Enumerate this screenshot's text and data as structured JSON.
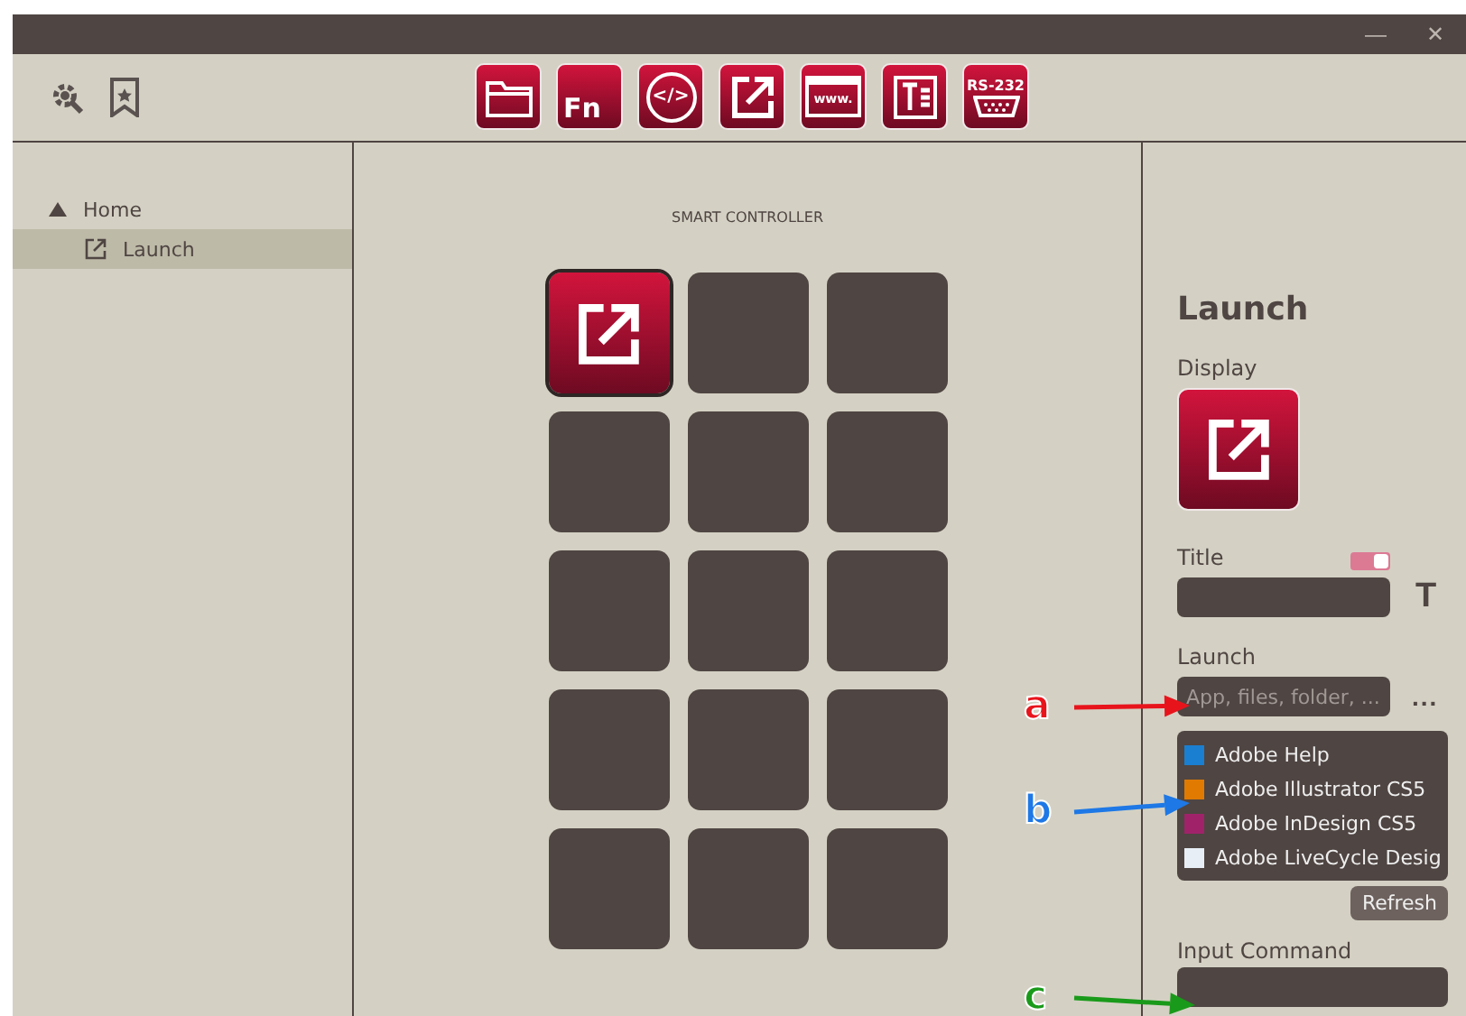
{
  "window": {
    "title_bar": {
      "minimize": "—",
      "close": "✕"
    }
  },
  "toolbar": {
    "tools": [
      {
        "kind": "folder"
      },
      {
        "kind": "fn",
        "label": "Fn"
      },
      {
        "kind": "code",
        "label": "</>"
      },
      {
        "kind": "launch"
      },
      {
        "kind": "browser",
        "label": "www."
      },
      {
        "kind": "text"
      },
      {
        "kind": "serial",
        "label": "RS-232"
      }
    ]
  },
  "sidebar": {
    "items": [
      {
        "label": "Home",
        "expanded": true,
        "selected": false,
        "children": [
          {
            "label": "Launch",
            "selected": true
          }
        ]
      }
    ]
  },
  "canvas": {
    "title": "SMART CONTROLLER",
    "rows": [
      [
        {
          "kind": "launch",
          "selected": true
        },
        {
          "kind": "empty",
          "selected": false
        },
        {
          "kind": "empty",
          "selected": false
        }
      ],
      [
        {
          "kind": "empty",
          "selected": false
        },
        {
          "kind": "empty",
          "selected": false
        },
        {
          "kind": "empty",
          "selected": false
        }
      ],
      [
        {
          "kind": "empty",
          "selected": false
        },
        {
          "kind": "empty",
          "selected": false
        },
        {
          "kind": "empty",
          "selected": false
        }
      ],
      [
        {
          "kind": "empty",
          "selected": false
        },
        {
          "kind": "empty",
          "selected": false
        },
        {
          "kind": "empty",
          "selected": false
        }
      ],
      [
        {
          "kind": "empty",
          "selected": false
        },
        {
          "kind": "empty",
          "selected": false
        },
        {
          "kind": "empty",
          "selected": false
        }
      ]
    ]
  },
  "properties": {
    "heading": "Launch",
    "display_label": "Display",
    "title_label": "Title",
    "title_toggle": {
      "on": true
    },
    "title_font_button": "T",
    "launch_label": "Launch",
    "launch_field": {
      "placeholder": "App, files, folder, ..."
    },
    "browse_button": "...",
    "apps": [
      {
        "label": "Adobe Help",
        "kind": "help"
      },
      {
        "label": "Adobe Illustrator CS5",
        "kind": "ai"
      },
      {
        "label": "Adobe InDesign CS5",
        "kind": "id"
      },
      {
        "label": "Adobe LiveCycle Desig",
        "kind": "lc"
      }
    ],
    "refresh_button": "Refresh",
    "command_label": "Input Command"
  },
  "annotations": [
    {
      "label": "a",
      "color": "#e8141c"
    },
    {
      "label": "b",
      "color": "#1e78e6"
    },
    {
      "label": "c",
      "color": "#1a9a1a"
    }
  ]
}
